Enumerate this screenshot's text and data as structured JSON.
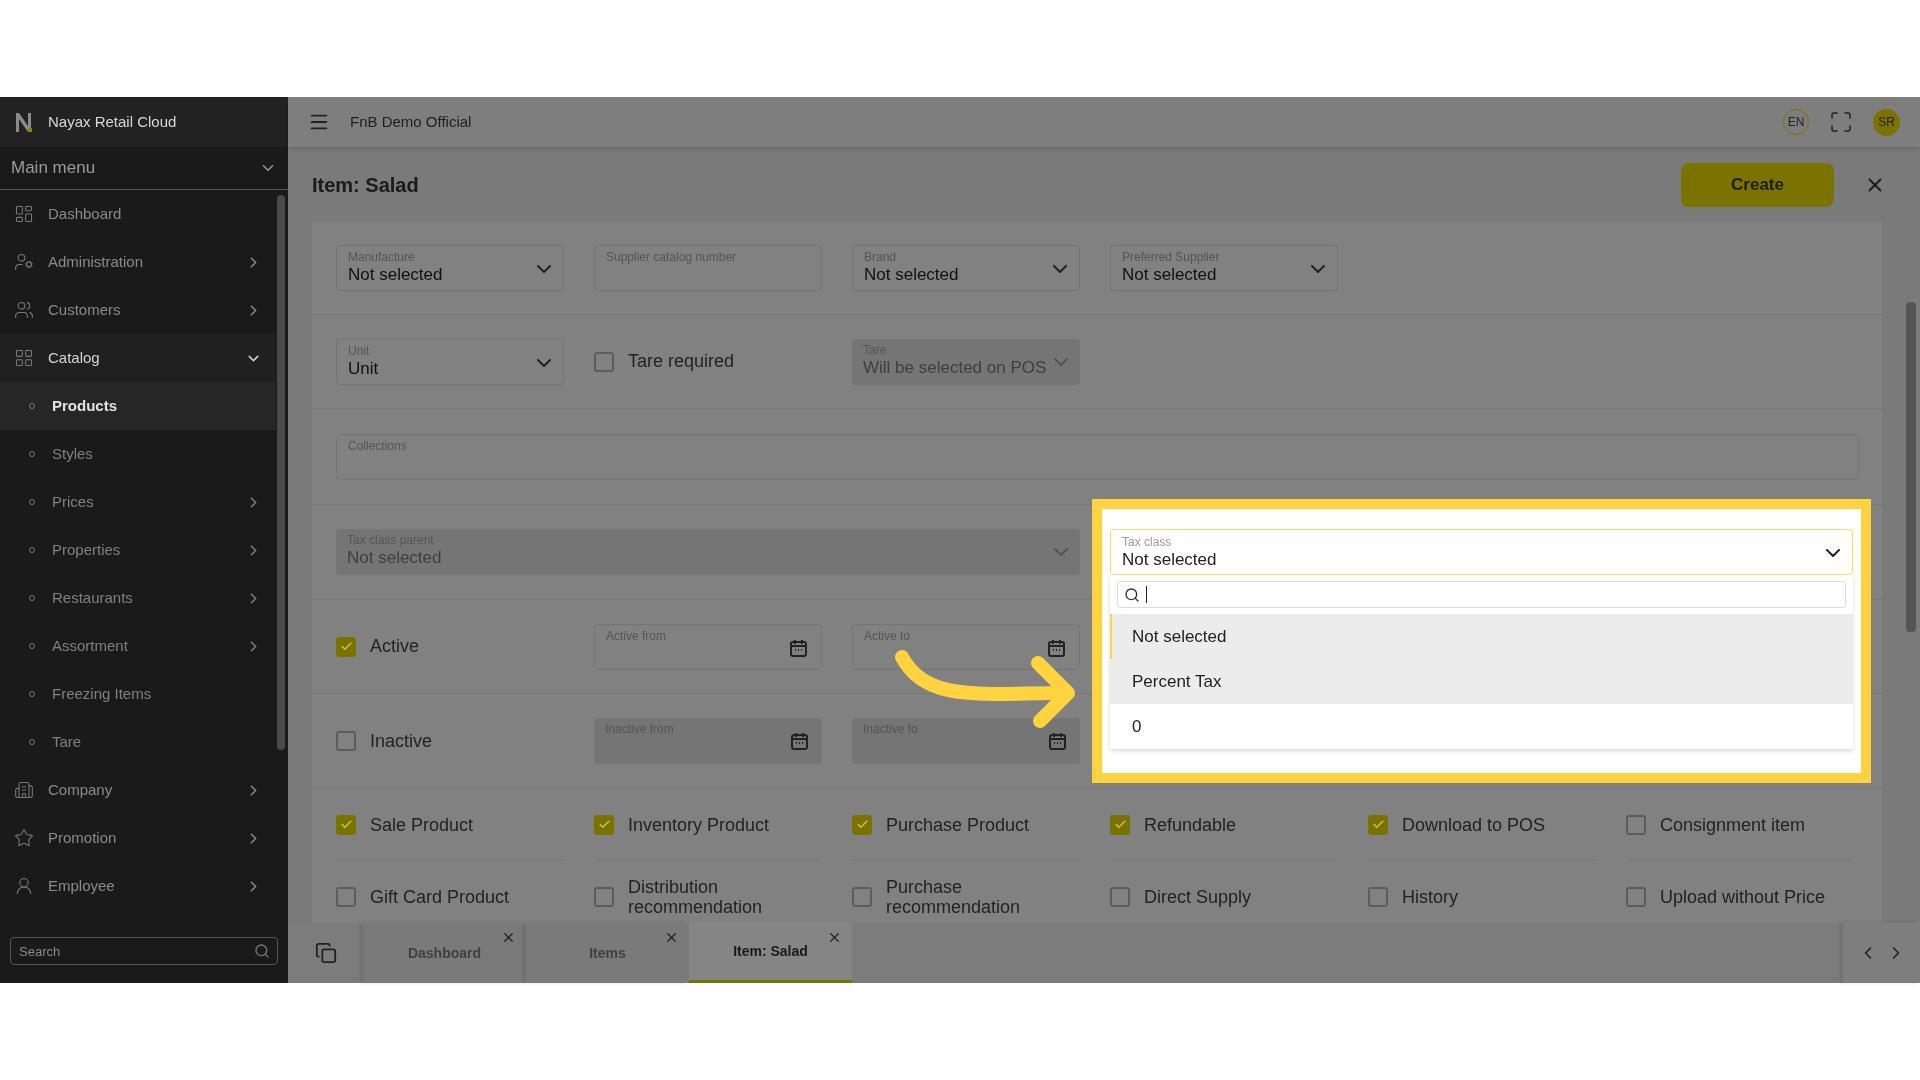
{
  "sidebar": {
    "brand": "Nayax Retail Cloud",
    "menu_header": "Main menu",
    "items": [
      {
        "label": "Dashboard",
        "kind": "link",
        "selected": false
      },
      {
        "label": "Administration",
        "kind": "group",
        "expanded": false,
        "selected": false
      },
      {
        "label": "Customers",
        "kind": "group",
        "expanded": false,
        "selected": false
      },
      {
        "label": "Catalog",
        "kind": "group",
        "expanded": true,
        "selected": true,
        "children": [
          {
            "label": "Products",
            "kind": "link",
            "selected": true
          },
          {
            "label": "Styles",
            "kind": "link",
            "selected": false
          },
          {
            "label": "Prices",
            "kind": "group",
            "expanded": false,
            "selected": false
          },
          {
            "label": "Properties",
            "kind": "group",
            "expanded": false,
            "selected": false
          },
          {
            "label": "Restaurants",
            "kind": "group",
            "expanded": false,
            "selected": false
          },
          {
            "label": "Assortment",
            "kind": "group",
            "expanded": false,
            "selected": false
          },
          {
            "label": "Freezing Items",
            "kind": "link",
            "selected": false
          },
          {
            "label": "Tare",
            "kind": "link",
            "selected": false
          }
        ]
      },
      {
        "label": "Company",
        "kind": "group",
        "expanded": false,
        "selected": false
      },
      {
        "label": "Promotion",
        "kind": "group",
        "expanded": false,
        "selected": false
      },
      {
        "label": "Employee",
        "kind": "group",
        "expanded": false,
        "selected": false
      }
    ],
    "search": {
      "placeholder": "Search"
    }
  },
  "topbar": {
    "title": "FnB Demo Official",
    "language": "EN",
    "avatar": "SR"
  },
  "page": {
    "title": "Item: Salad",
    "create_button": "Create"
  },
  "form_rows": [
    {
      "fields": [
        {
          "kind": "select",
          "label": "Manufacture",
          "value": "Not selected",
          "disabled": false
        },
        {
          "kind": "text",
          "label": "Supplier catalog number",
          "disabled": false
        },
        {
          "kind": "select",
          "label": "Brand",
          "value": "Not selected",
          "disabled": false
        },
        {
          "kind": "select",
          "label": "Preferred Supplier",
          "value": "Not selected",
          "disabled": false
        }
      ]
    },
    {
      "fields": [
        {
          "kind": "select",
          "label": "Unit",
          "value": "Unit",
          "disabled": false
        },
        {
          "kind": "checkbox",
          "label": "Tare required",
          "checked": false
        },
        {
          "kind": "select",
          "label": "Tare",
          "value": "Will be selected on POS",
          "disabled": true
        }
      ]
    },
    {
      "fields": [
        {
          "kind": "wide-text",
          "label": "Collections",
          "disabled": false
        }
      ]
    },
    {
      "fields": [
        {
          "kind": "wide-select",
          "label": "Tax class parent",
          "value": "Not selected",
          "disabled": true
        }
      ]
    },
    {
      "fields": [
        {
          "kind": "checkbox",
          "label": "Active",
          "checked": true
        },
        {
          "kind": "date",
          "label": "Active from",
          "disabled": false
        },
        {
          "kind": "date",
          "label": "Active to",
          "disabled": false
        }
      ]
    },
    {
      "fields": [
        {
          "kind": "checkbox",
          "label": "Inactive",
          "checked": false
        },
        {
          "kind": "date",
          "label": "Inactive from",
          "disabled": true
        },
        {
          "kind": "date",
          "label": "Inactive to",
          "disabled": true
        }
      ]
    }
  ],
  "flags": [
    {
      "label": "Sale Product",
      "checked": true
    },
    {
      "label": "Inventory Product",
      "checked": true
    },
    {
      "label": "Purchase Product",
      "checked": true
    },
    {
      "label": "Refundable",
      "checked": true
    },
    {
      "label": "Download to POS",
      "checked": true
    },
    {
      "label": "Consignment item",
      "checked": false
    },
    {
      "label": "Gift Card Product",
      "checked": false
    },
    {
      "label": "Distribution recommendation",
      "checked": false
    },
    {
      "label": "Purchase recommendation",
      "checked": false
    },
    {
      "label": "Direct Supply",
      "checked": false
    },
    {
      "label": "History",
      "checked": false
    },
    {
      "label": "Upload without Price",
      "checked": false
    }
  ],
  "tax_class": {
    "label": "Tax class",
    "value": "Not selected",
    "expanded": true,
    "options": [
      {
        "label": "Not selected",
        "selected": true,
        "hovered": true
      },
      {
        "label": "Percent Tax",
        "selected": false,
        "hovered": true
      },
      {
        "label": "0",
        "selected": false,
        "hovered": false
      }
    ]
  },
  "bottom_tabs": [
    {
      "label": "Dashboard",
      "selected": false
    },
    {
      "label": "Items",
      "selected": false
    },
    {
      "label": "Item: Salad",
      "selected": true
    }
  ]
}
